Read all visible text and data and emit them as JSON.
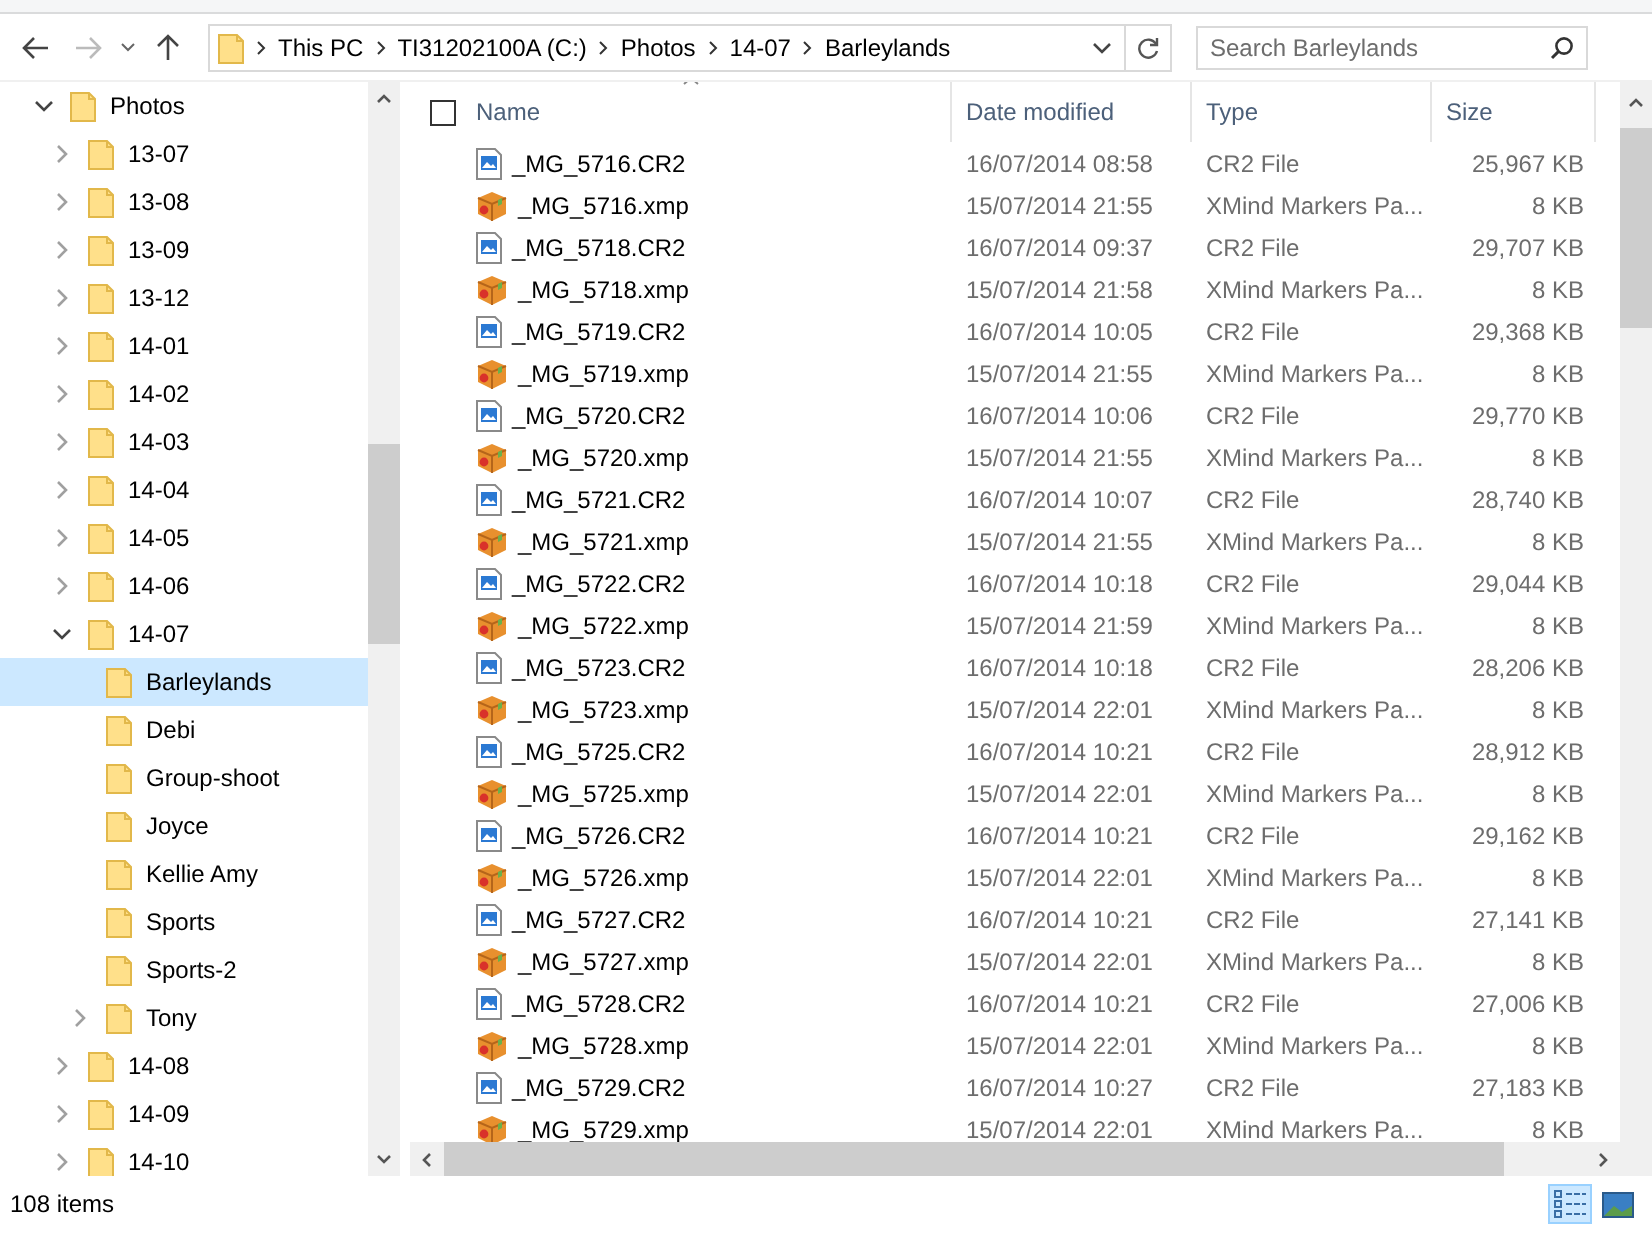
{
  "toolbar": {
    "path": [
      "This PC",
      "TI31202100A (C:)",
      "Photos",
      "14-07",
      "Barleylands"
    ],
    "search": {
      "placeholder": "Search Barleylands"
    }
  },
  "tree": [
    {
      "label": "Photos",
      "expandable": true,
      "expanded": true,
      "selected": false,
      "children": [
        {
          "label": "13-07",
          "expandable": true,
          "expanded": false,
          "selected": false
        },
        {
          "label": "13-08",
          "expandable": true,
          "expanded": false,
          "selected": false
        },
        {
          "label": "13-09",
          "expandable": true,
          "expanded": false,
          "selected": false
        },
        {
          "label": "13-12",
          "expandable": true,
          "expanded": false,
          "selected": false
        },
        {
          "label": "14-01",
          "expandable": true,
          "expanded": false,
          "selected": false
        },
        {
          "label": "14-02",
          "expandable": true,
          "expanded": false,
          "selected": false
        },
        {
          "label": "14-03",
          "expandable": true,
          "expanded": false,
          "selected": false
        },
        {
          "label": "14-04",
          "expandable": true,
          "expanded": false,
          "selected": false
        },
        {
          "label": "14-05",
          "expandable": true,
          "expanded": false,
          "selected": false
        },
        {
          "label": "14-06",
          "expandable": true,
          "expanded": false,
          "selected": false
        },
        {
          "label": "14-07",
          "expandable": true,
          "expanded": true,
          "selected": false,
          "children": [
            {
              "label": "Barleylands",
              "expandable": false,
              "expanded": false,
              "selected": true
            },
            {
              "label": "Debi",
              "expandable": false,
              "expanded": false,
              "selected": false
            },
            {
              "label": "Group-shoot",
              "expandable": false,
              "expanded": false,
              "selected": false
            },
            {
              "label": "Joyce",
              "expandable": false,
              "expanded": false,
              "selected": false
            },
            {
              "label": "Kellie Amy",
              "expandable": false,
              "expanded": false,
              "selected": false
            },
            {
              "label": "Sports",
              "expandable": false,
              "expanded": false,
              "selected": false
            },
            {
              "label": "Sports-2",
              "expandable": false,
              "expanded": false,
              "selected": false
            },
            {
              "label": "Tony",
              "expandable": true,
              "expanded": false,
              "selected": false
            }
          ]
        },
        {
          "label": "14-08",
          "expandable": true,
          "expanded": false,
          "selected": false
        },
        {
          "label": "14-09",
          "expandable": true,
          "expanded": false,
          "selected": false
        },
        {
          "label": "14-10",
          "expandable": true,
          "expanded": false,
          "selected": false
        }
      ]
    }
  ],
  "table": {
    "select_all_checked": false,
    "columns": [
      "Name",
      "Date modified",
      "Type",
      "Size"
    ],
    "rows": [
      {
        "kind": "image",
        "name": "_MG_5716.CR2",
        "date": "16/07/2014 08:58",
        "type": "CR2 File",
        "size": "25,967 KB"
      },
      {
        "kind": "package",
        "name": "_MG_5716.xmp",
        "date": "15/07/2014 21:55",
        "type": "XMind Markers Pa...",
        "size": "8 KB"
      },
      {
        "kind": "image",
        "name": "_MG_5718.CR2",
        "date": "16/07/2014 09:37",
        "type": "CR2 File",
        "size": "29,707 KB"
      },
      {
        "kind": "package",
        "name": "_MG_5718.xmp",
        "date": "15/07/2014 21:58",
        "type": "XMind Markers Pa...",
        "size": "8 KB"
      },
      {
        "kind": "image",
        "name": "_MG_5719.CR2",
        "date": "16/07/2014 10:05",
        "type": "CR2 File",
        "size": "29,368 KB"
      },
      {
        "kind": "package",
        "name": "_MG_5719.xmp",
        "date": "15/07/2014 21:55",
        "type": "XMind Markers Pa...",
        "size": "8 KB"
      },
      {
        "kind": "image",
        "name": "_MG_5720.CR2",
        "date": "16/07/2014 10:06",
        "type": "CR2 File",
        "size": "29,770 KB"
      },
      {
        "kind": "package",
        "name": "_MG_5720.xmp",
        "date": "15/07/2014 21:55",
        "type": "XMind Markers Pa...",
        "size": "8 KB"
      },
      {
        "kind": "image",
        "name": "_MG_5721.CR2",
        "date": "16/07/2014 10:07",
        "type": "CR2 File",
        "size": "28,740 KB"
      },
      {
        "kind": "package",
        "name": "_MG_5721.xmp",
        "date": "15/07/2014 21:55",
        "type": "XMind Markers Pa...",
        "size": "8 KB"
      },
      {
        "kind": "image",
        "name": "_MG_5722.CR2",
        "date": "16/07/2014 10:18",
        "type": "CR2 File",
        "size": "29,044 KB"
      },
      {
        "kind": "package",
        "name": "_MG_5722.xmp",
        "date": "15/07/2014 21:59",
        "type": "XMind Markers Pa...",
        "size": "8 KB"
      },
      {
        "kind": "image",
        "name": "_MG_5723.CR2",
        "date": "16/07/2014 10:18",
        "type": "CR2 File",
        "size": "28,206 KB"
      },
      {
        "kind": "package",
        "name": "_MG_5723.xmp",
        "date": "15/07/2014 22:01",
        "type": "XMind Markers Pa...",
        "size": "8 KB"
      },
      {
        "kind": "image",
        "name": "_MG_5725.CR2",
        "date": "16/07/2014 10:21",
        "type": "CR2 File",
        "size": "28,912 KB"
      },
      {
        "kind": "package",
        "name": "_MG_5725.xmp",
        "date": "15/07/2014 22:01",
        "type": "XMind Markers Pa...",
        "size": "8 KB"
      },
      {
        "kind": "image",
        "name": "_MG_5726.CR2",
        "date": "16/07/2014 10:21",
        "type": "CR2 File",
        "size": "29,162 KB"
      },
      {
        "kind": "package",
        "name": "_MG_5726.xmp",
        "date": "15/07/2014 22:01",
        "type": "XMind Markers Pa...",
        "size": "8 KB"
      },
      {
        "kind": "image",
        "name": "_MG_5727.CR2",
        "date": "16/07/2014 10:21",
        "type": "CR2 File",
        "size": "27,141 KB"
      },
      {
        "kind": "package",
        "name": "_MG_5727.xmp",
        "date": "15/07/2014 22:01",
        "type": "XMind Markers Pa...",
        "size": "8 KB"
      },
      {
        "kind": "image",
        "name": "_MG_5728.CR2",
        "date": "16/07/2014 10:21",
        "type": "CR2 File",
        "size": "27,006 KB"
      },
      {
        "kind": "package",
        "name": "_MG_5728.xmp",
        "date": "15/07/2014 22:01",
        "type": "XMind Markers Pa...",
        "size": "8 KB"
      },
      {
        "kind": "image",
        "name": "_MG_5729.CR2",
        "date": "16/07/2014 10:27",
        "type": "CR2 File",
        "size": "27,183 KB"
      },
      {
        "kind": "package",
        "name": "_MG_5729.xmp",
        "date": "15/07/2014 22:01",
        "type": "XMind Markers Pa...",
        "size": "8 KB"
      }
    ]
  },
  "status_bar": {
    "item_count": "108 items",
    "view_buttons": [
      {
        "kind": "details",
        "selected": true
      },
      {
        "kind": "large_icons",
        "selected": false
      }
    ]
  }
}
